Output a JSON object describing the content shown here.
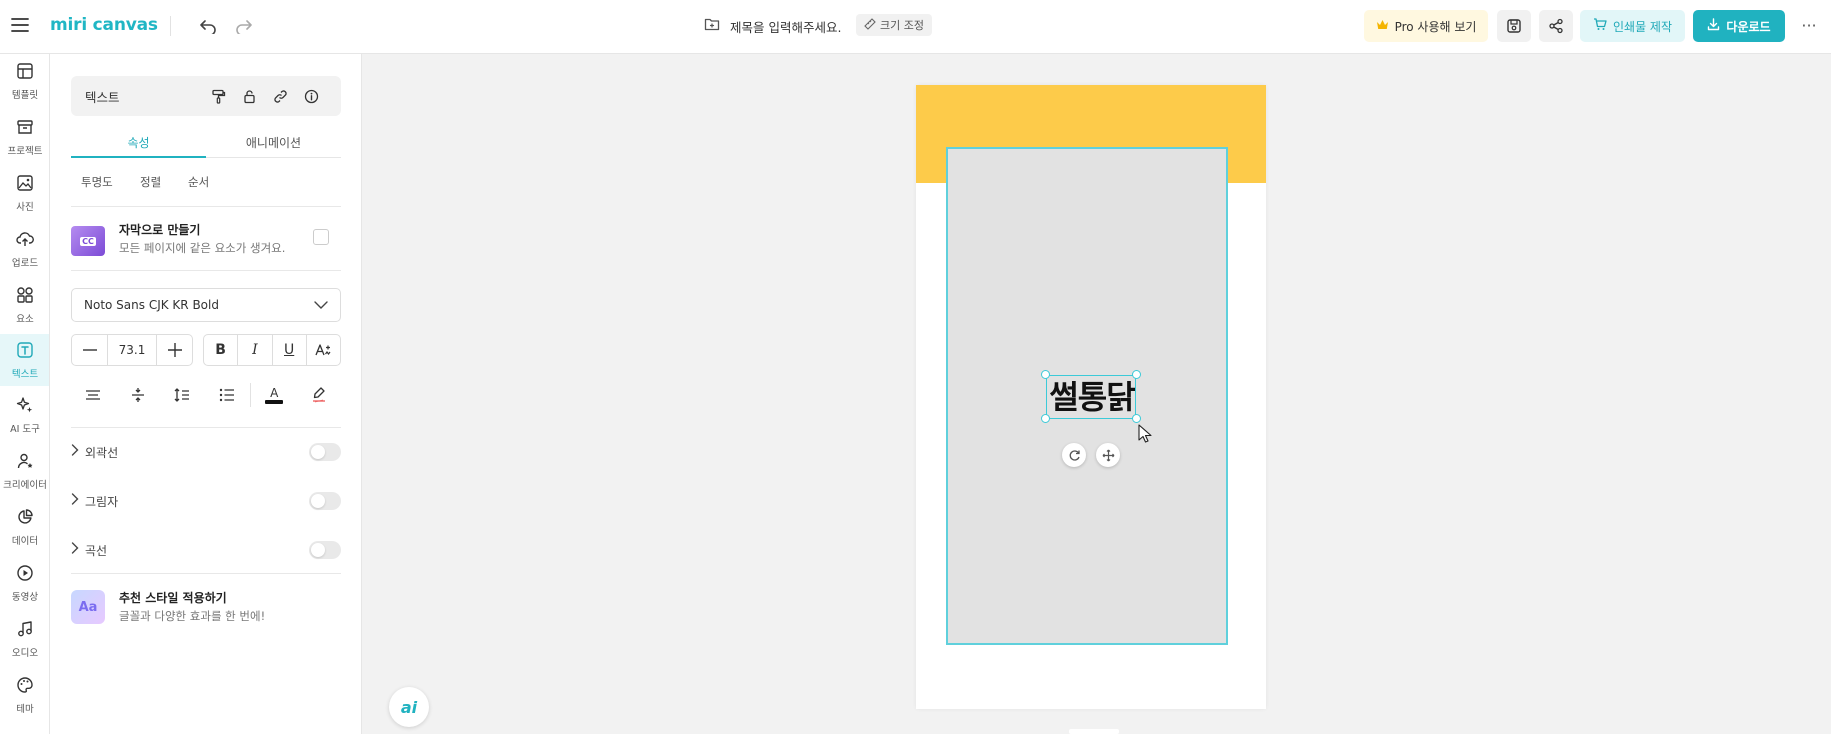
{
  "app": {
    "logo": "miri canvas",
    "brand_color": "#20b2c0"
  },
  "header": {
    "document_title": "제목을 입력해주세요.",
    "resize_label": "크기 조정",
    "pro_label": "Pro 사용해 보기",
    "print_label": "인쇄물 제작",
    "download_label": "다운로드",
    "more_label": "···"
  },
  "sidebar": {
    "items": [
      {
        "label": "템플릿",
        "icon": "template-icon"
      },
      {
        "label": "프로젝트",
        "icon": "archive-icon"
      },
      {
        "label": "사진",
        "icon": "image-icon"
      },
      {
        "label": "업로드",
        "icon": "upload-icon"
      },
      {
        "label": "요소",
        "icon": "shapes-icon"
      },
      {
        "label": "텍스트",
        "icon": "text-icon",
        "active": true
      },
      {
        "label": "AI 도구",
        "icon": "sparkle-icon"
      },
      {
        "label": "크리에이터",
        "icon": "creator-icon"
      },
      {
        "label": "데이터",
        "icon": "chart-icon"
      },
      {
        "label": "동영상",
        "icon": "video-icon"
      },
      {
        "label": "오디오",
        "icon": "music-icon"
      },
      {
        "label": "테마",
        "icon": "palette-icon"
      }
    ]
  },
  "panel": {
    "header_title": "텍스트",
    "tabs": {
      "attributes": "속성",
      "animation": "애니메이션"
    },
    "subtabs": {
      "opacity": "투명도",
      "align": "정렬",
      "order": "순서"
    },
    "caption": {
      "thumb_badge": "CC",
      "title": "자막으로 만들기",
      "description": "모든 페이지에 같은 요소가 생겨요."
    },
    "font": {
      "family": "Noto Sans CJK KR Bold",
      "size": "73.1"
    },
    "format": {
      "bold": "B",
      "italic": "I",
      "underline": "U"
    },
    "text_color_letter": "A",
    "sections": {
      "outline": "외곽선",
      "shadow": "그림자",
      "curve": "곡선"
    },
    "recommend": {
      "thumb": "Aa",
      "title": "추천 스타일 적용하기",
      "description": "글꼴과 다양한 효과를 한 번에!"
    }
  },
  "canvas": {
    "text": "썰통닭",
    "header_color": "#fdcb4a",
    "selection_color": "#3ccad8",
    "ai_label": "ai"
  }
}
